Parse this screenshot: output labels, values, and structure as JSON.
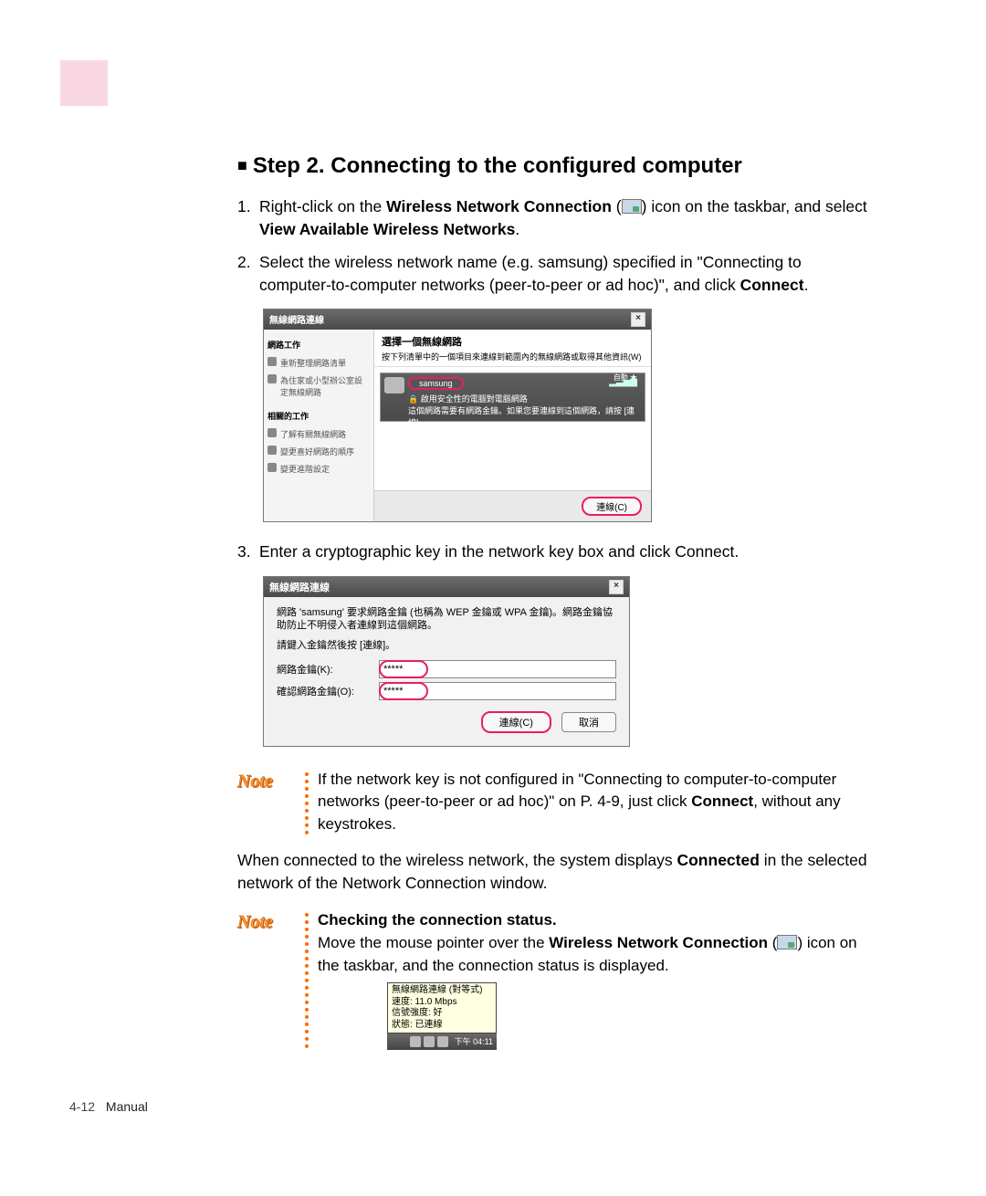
{
  "heading": "Step 2. Connecting to the configured computer",
  "steps": [
    {
      "num": "1.",
      "parts": [
        "Right-click on the ",
        "Wireless Network Connection",
        " (",
        ") icon on the taskbar, and select ",
        "View Available Wireless Networks",
        "."
      ]
    },
    {
      "num": "2.",
      "parts": [
        "Select the wireless network name (e.g. samsung) specified in \"Connecting to computer-to-computer networks (peer-to-peer or ad hoc)\", and click ",
        "Connect",
        "."
      ]
    },
    {
      "num": "3.",
      "text": "Enter a cryptographic key in the network key box and click Connect."
    }
  ],
  "shot1": {
    "title": "無線網路連線",
    "side_hdr1": "網路工作",
    "side_items1": [
      "重新整理網路清單",
      "為住家或小型辦公室設定無線網路"
    ],
    "side_hdr2": "相關的工作",
    "side_items2": [
      "了解有關無線網路",
      "變更喜好網路的順序",
      "變更進階設定"
    ],
    "main_hdr": "選擇一個無線網路",
    "main_sub": "按下列清單中的一個項目來連線到範圍內的無線網路或取得其他資訊(W)",
    "net_name": "samsung",
    "net_auto": "自動 ★",
    "net_line1": "🔒 啟用安全性的電腦對電腦網路",
    "net_line2": "這個網路需要有網路金鑰。如果您要連線到這個網路，請按 [連線]。",
    "connect_btn": "連線(C)"
  },
  "shot2": {
    "title": "無線網路連線",
    "msg": "網路 'samsung' 要求網路金鑰 (也稱為 WEP 金鑰或 WPA 金鑰)。網路金鑰協助防止不明侵入者連線到這個網路。",
    "msg2": "請鍵入金鑰然後按 [連線]。",
    "label1": "網路金鑰(K):",
    "label2": "確認網路金鑰(O):",
    "value1": "*****",
    "value2": "*****",
    "btn_connect": "連線(C)",
    "btn_cancel": "取消"
  },
  "note1_label": "Note",
  "note1_parts": [
    "If the network key is not configured in \"Connecting to computer-to-computer networks (peer-to-peer or ad hoc)\" on P. 4-9, just click ",
    "Connect",
    ", without any keystrokes."
  ],
  "connected_para_parts": [
    "When connected to the wireless network, the system displays ",
    "Connected",
    " in the selected network of the Network Connection window."
  ],
  "note2_label": "Note",
  "note2_heading": "Checking the connection status.",
  "note2_parts": [
    "Move the mouse pointer over the ",
    "Wireless Network Connection",
    " (",
    ") icon on the taskbar, and the connection status is displayed."
  ],
  "tooltip": {
    "line1": "無線網路連線 (對等式)",
    "line2": "速度: 11.0 Mbps",
    "line3": "信號強度: 好",
    "line4": "狀態: 已連線",
    "time": "下午 04:11"
  },
  "footer_page": "4-12",
  "footer_label": "Manual"
}
